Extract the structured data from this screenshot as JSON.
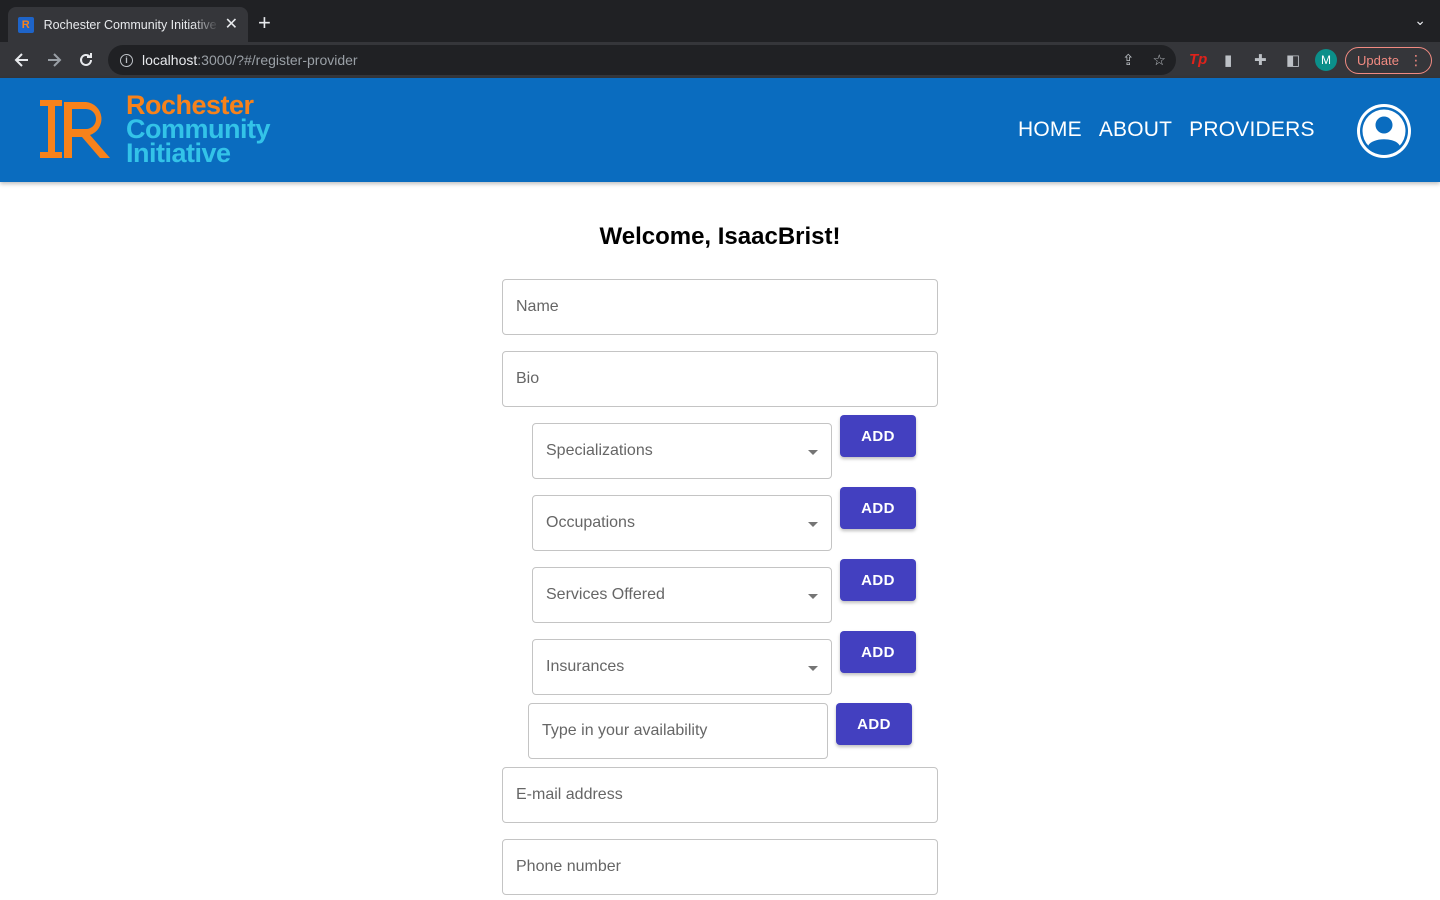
{
  "browser": {
    "tab_title": "Rochester Community Initiative",
    "tab_favicon_text": "R",
    "new_tab_symbol": "+",
    "url_host": "localhost",
    "url_path": ":3000/?#/register-provider",
    "profile_initial": "M",
    "update_label": "Update"
  },
  "header": {
    "logo_line1": "Rochester",
    "logo_line2": "Community",
    "logo_line3": "Initiative",
    "nav": [
      "HOME",
      "ABOUT",
      "PROVIDERS"
    ],
    "colors": {
      "bar": "#0a6cbf",
      "logo_orange": "#f7821b",
      "logo_cyan": "#33c3e8"
    }
  },
  "form": {
    "welcome": "Welcome, IsaacBrist!",
    "name_placeholder": "Name",
    "bio_placeholder": "Bio",
    "specializations": "Specializations",
    "occupations": "Occupations",
    "services": "Services Offered",
    "insurances": "Insurances",
    "availability_placeholder": "Type in your availability",
    "email_placeholder": "E-mail address",
    "phone_placeholder": "Phone number",
    "add_label": "ADD",
    "colors": {
      "add_button": "#4340c0"
    }
  }
}
